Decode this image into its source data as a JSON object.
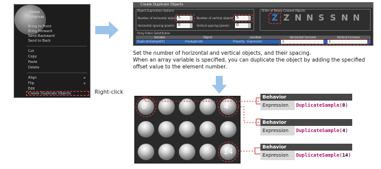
{
  "context_menu": {
    "ghost_lines": [
      "Group",
      "Ungroup"
    ],
    "items": [
      {
        "label": "Bring to Front"
      },
      {
        "label": "Bring Forward"
      },
      {
        "label": "Send Backward"
      },
      {
        "label": "Send to Back"
      },
      {
        "label": "Cut"
      },
      {
        "label": "Copy"
      },
      {
        "label": "Paste"
      },
      {
        "label": "Delete"
      },
      {
        "label": "Align"
      },
      {
        "label": "Flip"
      },
      {
        "label": "Edit"
      },
      {
        "label": "Create Duplicate Objects"
      }
    ],
    "submenu_arrow": "▸"
  },
  "right_click_label": "Right-click",
  "dialog": {
    "title": "Create Duplicate Objects",
    "options_header": "Object Duplication Options",
    "order_header": "Order of Newly Created Objects",
    "fields": {
      "horizontal_objects_label": "Number of horizontal objects",
      "horizontal_objects_value": "5",
      "vertical_objects_label": "Number of vertical objects",
      "vertical_objects_value": "5",
      "horizontal_spacing_label": "Horizontal spacing (pixels)",
      "horizontal_spacing_value": "0",
      "vertical_spacing_label": "Vertical spacing (pixels)",
      "vertical_spacing_value": "0"
    },
    "order_icons": [
      "Z",
      "Z",
      "N",
      "N",
      "S",
      "S",
      "N",
      "N"
    ],
    "array_header": "Array Index Substitution",
    "columns": [
      "Variable",
      "Object",
      "Location",
      "Horizontal Increase",
      "Vertical Increase"
    ],
    "row": [
      "DuplicateSample[0]",
      "lmoduplicate",
      "Property - Expression",
      "1",
      "5"
    ]
  },
  "description": {
    "line1": "Set the number of horizontal and vertical objects, and their spacing.",
    "line2": "When an array variable is specified, you can duplicate the object by adding the specified offset value to the element number."
  },
  "panel": {
    "labels": [
      "0",
      "4",
      "14"
    ]
  },
  "behaviors": [
    {
      "header": "Behavior",
      "label": "Expression",
      "fn": "DuplicateSample(",
      "index": "0",
      "close": ")"
    },
    {
      "header": "Behavior",
      "label": "Expression",
      "fn": "DuplicateSample(",
      "index": "4",
      "close": ")"
    },
    {
      "header": "Behavior",
      "label": "Expression",
      "fn": "DuplicateSample(",
      "index": "14",
      "close": ")"
    }
  ],
  "colors": {
    "accent_red": "#d13b3b",
    "arrow_blue": "#9cc3ea",
    "expression_magenta": "#b0136a"
  }
}
